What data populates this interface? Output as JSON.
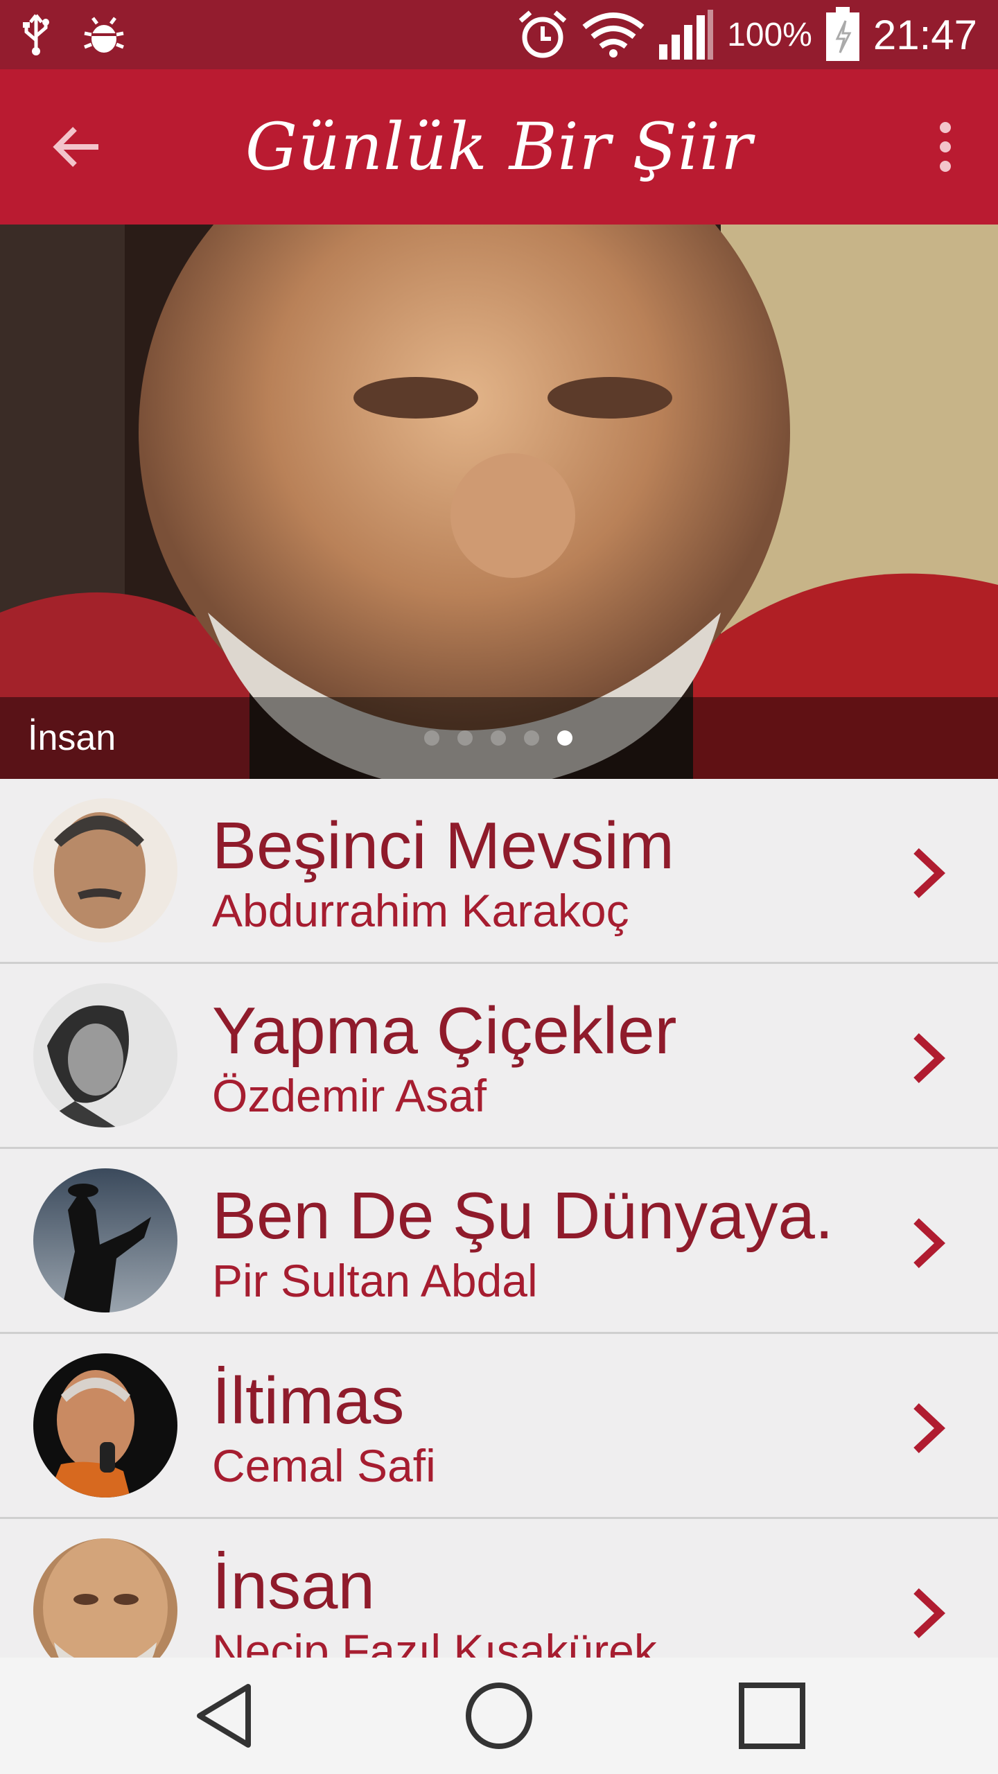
{
  "status": {
    "battery": "100%",
    "time": "21:47",
    "icons": [
      "usb-icon",
      "bug-icon",
      "alarm-icon",
      "wifi-icon",
      "signal-icon",
      "battery-icon"
    ]
  },
  "app_bar": {
    "title": "Günlük Bir Şiir",
    "icons": [
      "back-arrow-icon",
      "overflow-menu-icon"
    ]
  },
  "hero": {
    "caption": "İnsan",
    "slide_count": 5,
    "active_slide": 5
  },
  "poems": [
    {
      "title": "Beşinci Mevsim",
      "author": "Abdurrahim Karakoç"
    },
    {
      "title": "Yapma Çiçekler",
      "author": "Özdemir Asaf"
    },
    {
      "title": "Ben De Şu Dünyaya...",
      "author": "Pir Sultan Abdal"
    },
    {
      "title": "İltimas",
      "author": "Cemal Safi"
    },
    {
      "title": "İnsan",
      "author": "Necip Fazıl Kısakürek"
    }
  ],
  "nav": {
    "icons": [
      "back-triangle-icon",
      "home-circle-icon",
      "recents-square-icon"
    ]
  },
  "colors": {
    "status_bar": "#931c2e",
    "app_bar": "#ba1b31",
    "title_text": "#8f1b2b",
    "subtitle_text": "#a61d30",
    "list_bg": "#efeeef"
  }
}
